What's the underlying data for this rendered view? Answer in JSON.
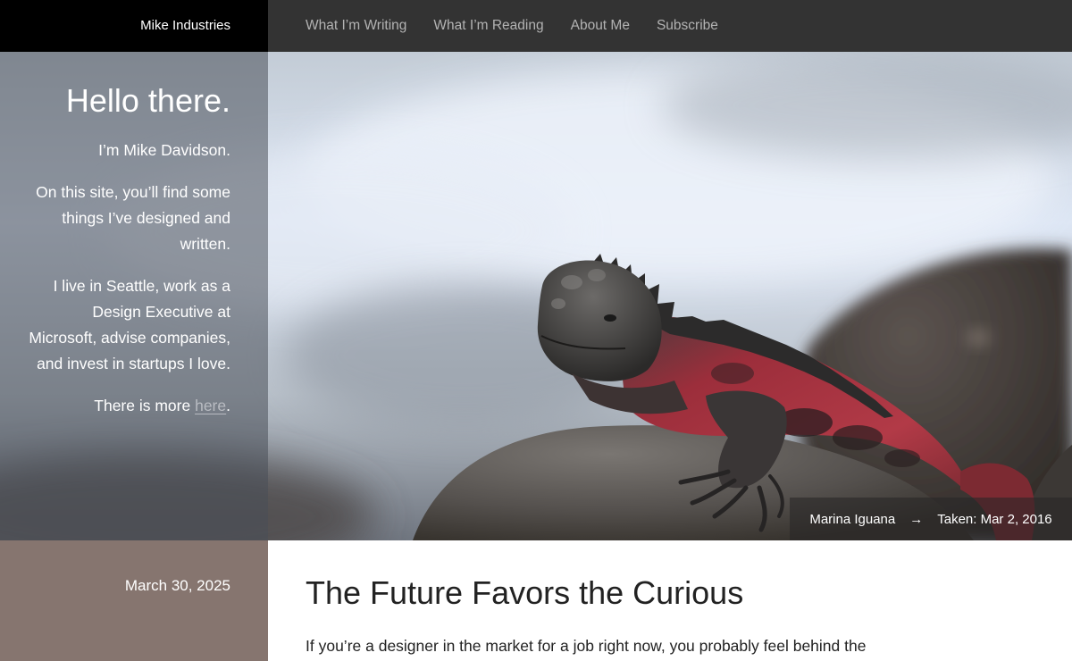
{
  "header": {
    "brand": "Mike Industries",
    "nav": [
      {
        "label": "What I’m Writing"
      },
      {
        "label": "What I’m Reading"
      },
      {
        "label": "About Me"
      },
      {
        "label": "Subscribe"
      }
    ]
  },
  "intro": {
    "heading": "Hello there.",
    "paragraphs": [
      "I’m Mike Davidson.",
      "On this site, you’ll find some things I’ve designed and written.",
      "I live in Seattle, work as a Design Executive at Microsoft, advise companies, and invest in startups I love."
    ],
    "more_prefix": "There is more ",
    "more_link": "here",
    "more_suffix": "."
  },
  "photo": {
    "title": "Marina Iguana",
    "arrow": "→",
    "taken": "Taken: Mar 2, 2016"
  },
  "post": {
    "date": "March 30, 2025",
    "title": "The Future Favors the Curious",
    "excerpt": "If you’re a designer in the market for a job right now, you probably feel behind the"
  },
  "colors": {
    "topbar": "#333333",
    "brand_bg": "#000000",
    "post_meta_bg": "#86756f",
    "iguana_red": "#a5303c"
  }
}
